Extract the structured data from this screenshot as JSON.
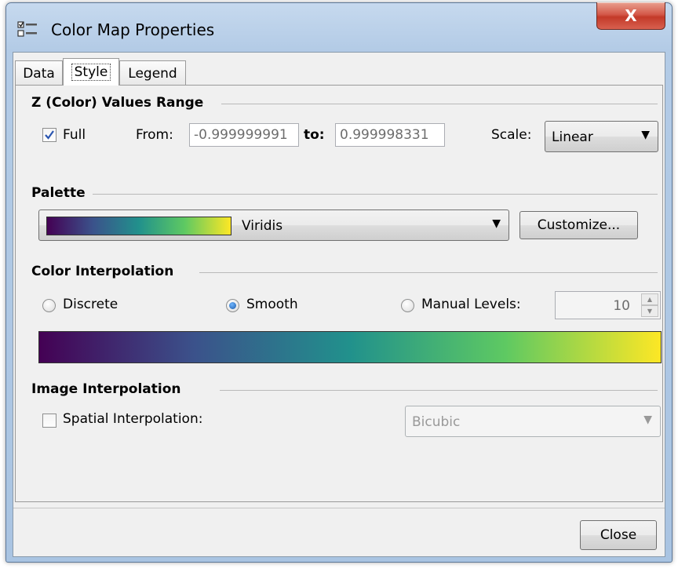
{
  "window": {
    "title": "Color Map Properties",
    "close_glyph": "X"
  },
  "tabs": [
    {
      "label": "Data",
      "active": false
    },
    {
      "label": "Style",
      "active": true
    },
    {
      "label": "Legend",
      "active": false
    }
  ],
  "z_range": {
    "title": "Z (Color) Values Range",
    "full_label": "Full",
    "full_checked": true,
    "from_label": "From:",
    "from_value": "-0.999999991",
    "to_label": "to:",
    "to_value": "0.999998331",
    "scale_label": "Scale:",
    "scale_value": "Linear"
  },
  "palette": {
    "title": "Palette",
    "selected": "Viridis",
    "customize_label": "Customize..."
  },
  "color_interpolation": {
    "title": "Color Interpolation",
    "discrete_label": "Discrete",
    "smooth_label": "Smooth",
    "manual_label": "Manual Levels:",
    "selected": "Smooth",
    "levels_value": "10"
  },
  "image_interpolation": {
    "title": "Image Interpolation",
    "spatial_label": "Spatial Interpolation:",
    "spatial_checked": false,
    "method_value": "Bicubic"
  },
  "footer": {
    "close_label": "Close"
  },
  "colors": {
    "viridis_gradient": [
      "#440154",
      "#3b528b",
      "#21918c",
      "#5ec962",
      "#fde725"
    ],
    "close_button": "#c9463a",
    "checkmark": "#2a55b0"
  },
  "icons": {
    "app": "properties-list-icon",
    "check": "checkmark-icon",
    "dropdown": "chevron-down-icon"
  }
}
